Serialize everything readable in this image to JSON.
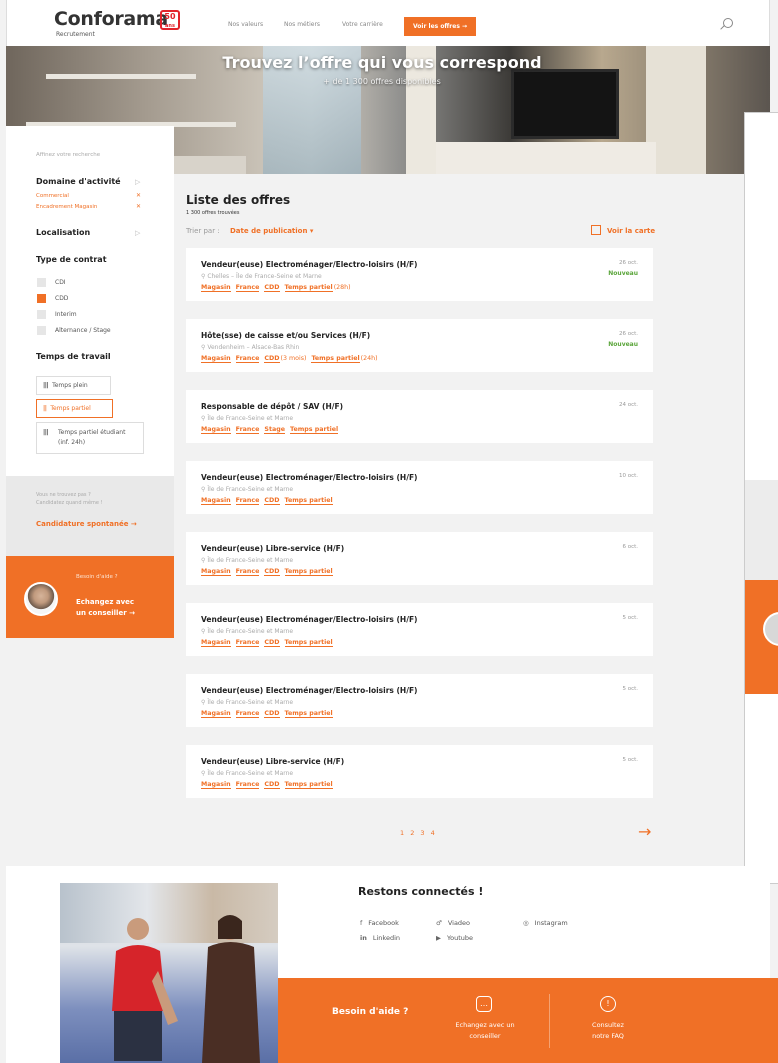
{
  "header": {
    "brand": "Conforama",
    "brand_sub": "Recrutement",
    "badge": "50 ans",
    "nav": [
      "Nos valeurs",
      "Nos métiers",
      "Votre carrière"
    ],
    "cta": "Voir les offres →"
  },
  "hero": {
    "title": "Trouvez l’offre qui vous correspond",
    "subtitle": "+ de 1 300 offres disponibles"
  },
  "sidebar": {
    "refine_label": "Affinez votre recherche",
    "domain_title": "Domaine d'activité",
    "domain_selected": [
      "Commercial",
      "Encadrement Magasin"
    ],
    "location_title": "Localisation",
    "contract_title": "Type de contrat",
    "contracts": [
      {
        "label": "CDI",
        "checked": false
      },
      {
        "label": "CDD",
        "checked": true
      },
      {
        "label": "Interim",
        "checked": false
      },
      {
        "label": "Alternance / Stage",
        "checked": false
      }
    ],
    "worktime_title": "Temps de travail",
    "worktimes": [
      {
        "label": "Temps plein",
        "active": false
      },
      {
        "label": "Temps partiel",
        "active": true
      },
      {
        "label": "Temps partiel étudiant",
        "label2": "(inf. 24h)",
        "active": false
      }
    ],
    "spont_text1": "Vous ne trouvez pas ?",
    "spont_text2": "Candidatez quand même !",
    "spont_link": "Candidature spontanée  →",
    "help_label": "Besoin d'aide ?",
    "help_link1": "Echangez avec",
    "help_link2": "un conseiller  →"
  },
  "list": {
    "title": "Liste des offres",
    "count": "1 300 offres trouvées",
    "sort_label": "Trier par :",
    "sort_value": "Date de publication ▾",
    "map_link": "Voir la carte",
    "pages": "1 2 3 4",
    "next": "→"
  },
  "offers": [
    {
      "title": "Vendeur(euse) Electroménager/Electro-loisirs (H/F)",
      "location": "Chelles – Île de France-Seine et Marne",
      "tags": [
        "Magasin",
        "France",
        "CDD",
        "Temps partiel"
      ],
      "tag_suffix": "(28h)",
      "date": "26 oct.",
      "new": "Nouveau"
    },
    {
      "title": "Hôte(sse) de caisse et/ou Services (H/F)",
      "location": "Vendenheim – Alsace-Bas Rhin",
      "tags": [
        "Magasin",
        "France",
        "CDD",
        "Temps partiel"
      ],
      "cdd_suffix": "(3 mois)",
      "tag_suffix": "(24h)",
      "date": "26 oct.",
      "new": "Nouveau"
    },
    {
      "title": "Responsable de dépôt / SAV (H/F)",
      "location": "Île de France-Seine et Marne",
      "tags": [
        "Magasin",
        "France",
        "Stage",
        "Temps partiel"
      ],
      "date": "24 oct."
    },
    {
      "title": "Vendeur(euse) Electroménager/Electro-loisirs (H/F)",
      "location": "Île de France-Seine et Marne",
      "tags": [
        "Magasin",
        "France",
        "CDD",
        "Temps partiel"
      ],
      "date": "10 oct."
    },
    {
      "title": "Vendeur(euse) Libre-service (H/F)",
      "location": "Île de France-Seine et Marne",
      "tags": [
        "Magasin",
        "France",
        "CDD",
        "Temps partiel"
      ],
      "date": "6 oct."
    },
    {
      "title": "Vendeur(euse) Electroménager/Electro-loisirs (H/F)",
      "location": "Île de France-Seine et Marne",
      "tags": [
        "Magasin",
        "France",
        "CDD",
        "Temps partiel"
      ],
      "date": "5 oct."
    },
    {
      "title": "Vendeur(euse) Electroménager/Electro-loisirs (H/F)",
      "location": "Île de France-Seine et Marne",
      "tags": [
        "Magasin",
        "France",
        "CDD",
        "Temps partiel"
      ],
      "date": "5 oct."
    },
    {
      "title": "Vendeur(euse) Libre-service (H/F)",
      "location": "Île de France-Seine et Marne",
      "tags": [
        "Magasin",
        "France",
        "CDD",
        "Temps partiel"
      ],
      "date": "5 oct."
    }
  ],
  "footer": {
    "stay_title": "Restons connectés !",
    "socials": [
      "Facebook",
      "Viadeo",
      "Instagram",
      "Linkedin",
      "Youtube"
    ],
    "need_help": "Besoin d'aide ?",
    "chat1": "Echangez avec un",
    "chat2": "conseiller",
    "faq1": "Consultez",
    "faq2": "notre FAQ"
  },
  "colors": {
    "accent": "#f07026",
    "new": "#5aa53a"
  }
}
